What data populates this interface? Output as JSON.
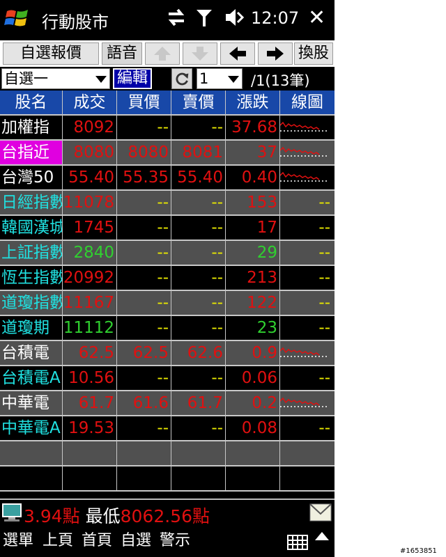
{
  "title_bar": {
    "app_title": "行動股市",
    "clock": "12:07"
  },
  "toolbar": {
    "watchlist_label": "自選報價",
    "voice_label": "語音",
    "switch_label": "換股"
  },
  "selector": {
    "group_value": "自選一",
    "edit_label": "編輯",
    "page_value": "1",
    "page_info": "/1(13筆)"
  },
  "table": {
    "headers": [
      "股名",
      "成交",
      "買價",
      "賣價",
      "漲跌",
      "線圖"
    ],
    "rows": [
      {
        "name": "加權指",
        "name_color": "#ffffff",
        "bg": "#000000",
        "last": "8092",
        "last_color": "#e01010",
        "bid": "--",
        "bid_color": "#e8e800",
        "ask": "--",
        "ask_color": "#e8e800",
        "chg": "37.68",
        "chg_color": "#e01010",
        "chart": "red",
        "dash_chart": false
      },
      {
        "name": "台指近",
        "name_color": "#ffffff",
        "name_bg": "#e000e0",
        "bg": "#505050",
        "last": "8080",
        "last_color": "#e01010",
        "bid": "8080",
        "bid_color": "#e01010",
        "ask": "8081",
        "ask_color": "#e01010",
        "chg": "37",
        "chg_color": "#e01010",
        "chart": "red",
        "dash_chart": false
      },
      {
        "name": "台灣50",
        "name_color": "#ffffff",
        "bg": "#000000",
        "last": "55.40",
        "last_color": "#e01010",
        "bid": "55.35",
        "bid_color": "#e01010",
        "ask": "55.40",
        "ask_color": "#e01010",
        "chg": "0.40",
        "chg_color": "#e01010",
        "chart": "red",
        "dash_chart": false
      },
      {
        "name": "日經指數",
        "name_color": "#20e0e0",
        "bg": "#505050",
        "last": "11078",
        "last_color": "#e01010",
        "bid": "--",
        "bid_color": "#e8e800",
        "ask": "--",
        "ask_color": "#e8e800",
        "chg": "153",
        "chg_color": "#e01010",
        "chart": "",
        "dash_chart": true
      },
      {
        "name": "韓國漢城",
        "name_color": "#20e0e0",
        "bg": "#000000",
        "last": "1745",
        "last_color": "#e01010",
        "bid": "--",
        "bid_color": "#e8e800",
        "ask": "--",
        "ask_color": "#e8e800",
        "chg": "17",
        "chg_color": "#e01010",
        "chart": "",
        "dash_chart": true
      },
      {
        "name": "上証指數",
        "name_color": "#20e0e0",
        "bg": "#505050",
        "last": "2840",
        "last_color": "#30d030",
        "bid": "--",
        "bid_color": "#e8e800",
        "ask": "--",
        "ask_color": "#e8e800",
        "chg": "29",
        "chg_color": "#30d030",
        "chart": "",
        "dash_chart": true
      },
      {
        "name": "恆生指數",
        "name_color": "#20e0e0",
        "bg": "#000000",
        "last": "20992",
        "last_color": "#e01010",
        "bid": "--",
        "bid_color": "#e8e800",
        "ask": "--",
        "ask_color": "#e8e800",
        "chg": "213",
        "chg_color": "#e01010",
        "chart": "",
        "dash_chart": true
      },
      {
        "name": "道瓊指數",
        "name_color": "#20e0e0",
        "bg": "#505050",
        "last": "11167",
        "last_color": "#e01010",
        "bid": "--",
        "bid_color": "#e8e800",
        "ask": "--",
        "ask_color": "#e8e800",
        "chg": "122",
        "chg_color": "#e01010",
        "chart": "",
        "dash_chart": true
      },
      {
        "name": "道瓊期",
        "name_color": "#20e0e0",
        "bg": "#000000",
        "last": "11112",
        "last_color": "#30d030",
        "bid": "--",
        "bid_color": "#e8e800",
        "ask": "--",
        "ask_color": "#e8e800",
        "chg": "23",
        "chg_color": "#30d030",
        "chart": "",
        "dash_chart": true
      },
      {
        "name": "台積電",
        "name_color": "#ffffff",
        "bg": "#505050",
        "last": "62.5",
        "last_color": "#e01010",
        "bid": "62.5",
        "bid_color": "#e01010",
        "ask": "62.6",
        "ask_color": "#e01010",
        "chg": "0.9",
        "chg_color": "#e01010",
        "chart": "red",
        "dash_chart": false
      },
      {
        "name": "台積電ADR",
        "name_color": "#20e0e0",
        "bg": "#000000",
        "last": "10.56",
        "last_color": "#e01010",
        "bid": "--",
        "bid_color": "#e8e800",
        "ask": "--",
        "ask_color": "#e8e800",
        "chg": "0.06",
        "chg_color": "#e01010",
        "chart": "",
        "dash_chart": true
      },
      {
        "name": "中華電",
        "name_color": "#ffffff",
        "bg": "#505050",
        "last": "61.7",
        "last_color": "#e01010",
        "bid": "61.6",
        "bid_color": "#e01010",
        "ask": "61.7",
        "ask_color": "#e01010",
        "chg": "0.2",
        "chg_color": "#e01010",
        "chart": "red",
        "dash_chart": false
      },
      {
        "name": "中華電ADR",
        "name_color": "#20e0e0",
        "bg": "#000000",
        "last": "19.53",
        "last_color": "#e01010",
        "bid": "--",
        "bid_color": "#e8e800",
        "ask": "--",
        "ask_color": "#e8e800",
        "chg": "0.08",
        "chg_color": "#e01010",
        "chart": "",
        "dash_chart": true
      },
      {
        "name": "",
        "bg": "#505050",
        "empty": true
      },
      {
        "name": "",
        "bg": "#000000",
        "empty": true
      }
    ]
  },
  "ticker": {
    "text_white1": "",
    "text_red1": "3.94點",
    "text_white2": " 最低",
    "text_red2": "8062.56點"
  },
  "softkeys": [
    "選單",
    "上頁",
    "首頁",
    "自選",
    "警示"
  ],
  "watermark": "#1653851",
  "colors": {
    "header_bg": "#1848a8",
    "row_dark": "#000000",
    "row_grey": "#505050",
    "up": "#e01010",
    "down": "#30d030",
    "dash": "#e8e800"
  }
}
